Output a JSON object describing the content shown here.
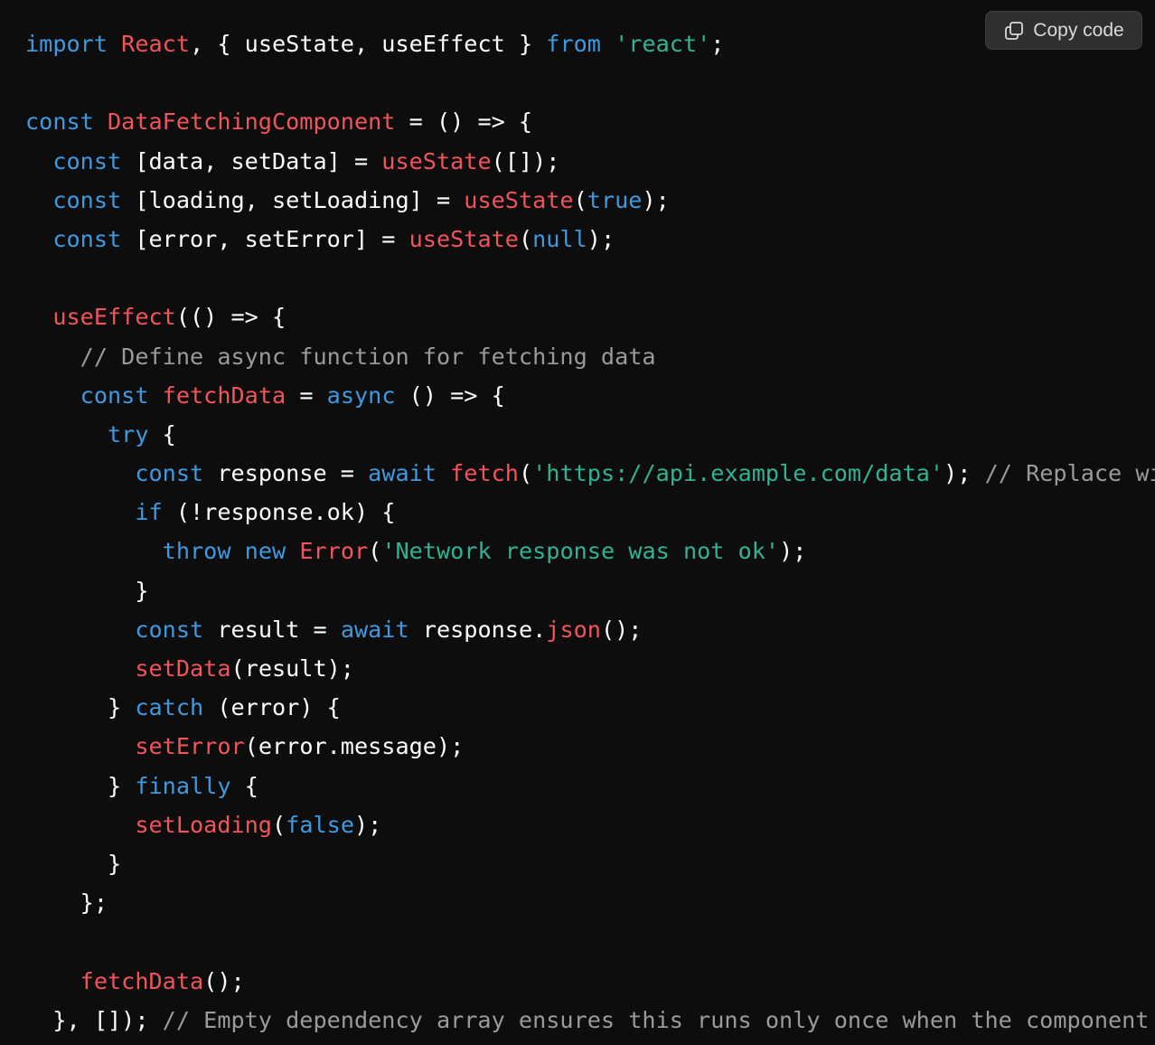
{
  "copy_button": {
    "label": "Copy code",
    "icon": "copy-icon"
  },
  "colors": {
    "background": "#0d0d0d",
    "keyword": "#3d99e0",
    "function": "#f2545b",
    "string": "#31b391",
    "comment": "#9a9a9a",
    "text": "#ffffff"
  },
  "code": {
    "language": "javascript",
    "lines": [
      [
        {
          "t": "kw",
          "v": "import"
        },
        {
          "t": "tx",
          "v": " "
        },
        {
          "t": "fn",
          "v": "React"
        },
        {
          "t": "tx",
          "v": ", { useState, useEffect } "
        },
        {
          "t": "kw",
          "v": "from"
        },
        {
          "t": "tx",
          "v": " "
        },
        {
          "t": "str",
          "v": "'react'"
        },
        {
          "t": "tx",
          "v": ";"
        }
      ],
      [],
      [
        {
          "t": "kw",
          "v": "const"
        },
        {
          "t": "tx",
          "v": " "
        },
        {
          "t": "fn",
          "v": "DataFetchingComponent"
        },
        {
          "t": "tx",
          "v": " = () => {"
        }
      ],
      [
        {
          "t": "tx",
          "v": "  "
        },
        {
          "t": "kw",
          "v": "const"
        },
        {
          "t": "tx",
          "v": " [data, setData] = "
        },
        {
          "t": "fn",
          "v": "useState"
        },
        {
          "t": "tx",
          "v": "([]);"
        }
      ],
      [
        {
          "t": "tx",
          "v": "  "
        },
        {
          "t": "kw",
          "v": "const"
        },
        {
          "t": "tx",
          "v": " [loading, setLoading] = "
        },
        {
          "t": "fn",
          "v": "useState"
        },
        {
          "t": "tx",
          "v": "("
        },
        {
          "t": "kw",
          "v": "true"
        },
        {
          "t": "tx",
          "v": ");"
        }
      ],
      [
        {
          "t": "tx",
          "v": "  "
        },
        {
          "t": "kw",
          "v": "const"
        },
        {
          "t": "tx",
          "v": " [error, setError] = "
        },
        {
          "t": "fn",
          "v": "useState"
        },
        {
          "t": "tx",
          "v": "("
        },
        {
          "t": "kw",
          "v": "null"
        },
        {
          "t": "tx",
          "v": ");"
        }
      ],
      [],
      [
        {
          "t": "tx",
          "v": "  "
        },
        {
          "t": "fn",
          "v": "useEffect"
        },
        {
          "t": "tx",
          "v": "(() => {"
        }
      ],
      [
        {
          "t": "tx",
          "v": "    "
        },
        {
          "t": "cm",
          "v": "// Define async function for fetching data"
        }
      ],
      [
        {
          "t": "tx",
          "v": "    "
        },
        {
          "t": "kw",
          "v": "const"
        },
        {
          "t": "tx",
          "v": " "
        },
        {
          "t": "fn",
          "v": "fetchData"
        },
        {
          "t": "tx",
          "v": " = "
        },
        {
          "t": "kw",
          "v": "async"
        },
        {
          "t": "tx",
          "v": " () => {"
        }
      ],
      [
        {
          "t": "tx",
          "v": "      "
        },
        {
          "t": "kw",
          "v": "try"
        },
        {
          "t": "tx",
          "v": " {"
        }
      ],
      [
        {
          "t": "tx",
          "v": "        "
        },
        {
          "t": "kw",
          "v": "const"
        },
        {
          "t": "tx",
          "v": " response = "
        },
        {
          "t": "kw",
          "v": "await"
        },
        {
          "t": "tx",
          "v": " "
        },
        {
          "t": "fn",
          "v": "fetch"
        },
        {
          "t": "tx",
          "v": "("
        },
        {
          "t": "str",
          "v": "'https://api.example.com/data'"
        },
        {
          "t": "tx",
          "v": "); "
        },
        {
          "t": "cm",
          "v": "// Replace wi"
        }
      ],
      [
        {
          "t": "tx",
          "v": "        "
        },
        {
          "t": "kw",
          "v": "if"
        },
        {
          "t": "tx",
          "v": " (!response.ok) {"
        }
      ],
      [
        {
          "t": "tx",
          "v": "          "
        },
        {
          "t": "kw",
          "v": "throw"
        },
        {
          "t": "tx",
          "v": " "
        },
        {
          "t": "kw",
          "v": "new"
        },
        {
          "t": "tx",
          "v": " "
        },
        {
          "t": "fn",
          "v": "Error"
        },
        {
          "t": "tx",
          "v": "("
        },
        {
          "t": "str",
          "v": "'Network response was not ok'"
        },
        {
          "t": "tx",
          "v": ");"
        }
      ],
      [
        {
          "t": "tx",
          "v": "        }"
        }
      ],
      [
        {
          "t": "tx",
          "v": "        "
        },
        {
          "t": "kw",
          "v": "const"
        },
        {
          "t": "tx",
          "v": " result = "
        },
        {
          "t": "kw",
          "v": "await"
        },
        {
          "t": "tx",
          "v": " response."
        },
        {
          "t": "fn",
          "v": "json"
        },
        {
          "t": "tx",
          "v": "();"
        }
      ],
      [
        {
          "t": "tx",
          "v": "        "
        },
        {
          "t": "fn",
          "v": "setData"
        },
        {
          "t": "tx",
          "v": "(result);"
        }
      ],
      [
        {
          "t": "tx",
          "v": "      } "
        },
        {
          "t": "kw",
          "v": "catch"
        },
        {
          "t": "tx",
          "v": " (error) {"
        }
      ],
      [
        {
          "t": "tx",
          "v": "        "
        },
        {
          "t": "fn",
          "v": "setError"
        },
        {
          "t": "tx",
          "v": "(error.message);"
        }
      ],
      [
        {
          "t": "tx",
          "v": "      } "
        },
        {
          "t": "kw",
          "v": "finally"
        },
        {
          "t": "tx",
          "v": " {"
        }
      ],
      [
        {
          "t": "tx",
          "v": "        "
        },
        {
          "t": "fn",
          "v": "setLoading"
        },
        {
          "t": "tx",
          "v": "("
        },
        {
          "t": "kw",
          "v": "false"
        },
        {
          "t": "tx",
          "v": ");"
        }
      ],
      [
        {
          "t": "tx",
          "v": "      }"
        }
      ],
      [
        {
          "t": "tx",
          "v": "    };"
        }
      ],
      [],
      [
        {
          "t": "tx",
          "v": "    "
        },
        {
          "t": "fn",
          "v": "fetchData"
        },
        {
          "t": "tx",
          "v": "();"
        }
      ],
      [
        {
          "t": "tx",
          "v": "  }, []); "
        },
        {
          "t": "cm",
          "v": "// Empty dependency array ensures this runs only once when the component"
        }
      ]
    ]
  }
}
